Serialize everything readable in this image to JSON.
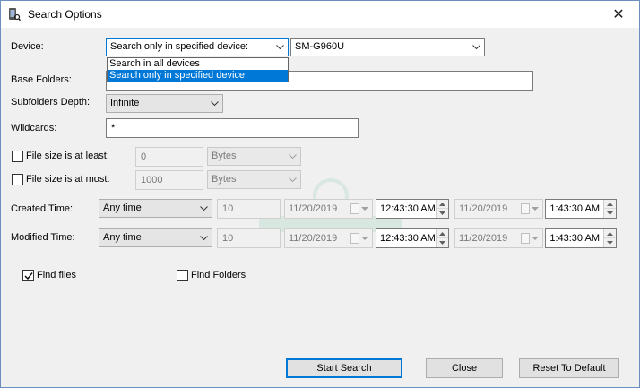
{
  "window": {
    "title": "Search Options",
    "close_glyph": "✕"
  },
  "device": {
    "label": "Device:",
    "mode_value": "Search only in specified device:",
    "mode_options": [
      "Search in all devices",
      "Search only in specified device:"
    ],
    "selected_option_index": 1,
    "device_value": "SM-G960U"
  },
  "base_folders": {
    "label": "Base Folders:",
    "value": ""
  },
  "subfolders": {
    "label": "Subfolders Depth:",
    "value": "Infinite"
  },
  "wildcards": {
    "label": "Wildcards:",
    "value": "*"
  },
  "size_at_least": {
    "label": "File size is at least:",
    "checked": false,
    "value": "0",
    "unit": "Bytes"
  },
  "size_at_most": {
    "label": "File size is at most:",
    "checked": false,
    "value": "1000",
    "unit": "Bytes"
  },
  "created_time": {
    "label": "Created Time:",
    "range": "Any time",
    "amount": "10",
    "from_date": "11/20/2019",
    "from_time": "12:43:30 AM",
    "to_date": "11/20/2019",
    "to_time": "1:43:30 AM"
  },
  "modified_time": {
    "label": "Modified Time:",
    "range": "Any time",
    "amount": "10",
    "from_date": "11/20/2019",
    "from_time": "12:43:30 AM",
    "to_date": "11/20/2019",
    "to_time": "1:43:30 AM"
  },
  "find_files": {
    "label": "Find files",
    "checked": true
  },
  "find_folders": {
    "label": "Find Folders",
    "checked": false
  },
  "buttons": {
    "start": "Start Search",
    "close": "Close",
    "reset": "Reset To Default"
  },
  "colors": {
    "accent": "#0078d7",
    "window_bg": "#f0f0f0"
  },
  "icons": {
    "app": "phone-search-icon",
    "close": "close-icon",
    "dropdown": "chevron-down-icon",
    "checkmark": "checkmark-icon",
    "calendar": "calendar-icon",
    "spin_up": "spin-up-icon",
    "spin_down": "spin-down-icon"
  }
}
